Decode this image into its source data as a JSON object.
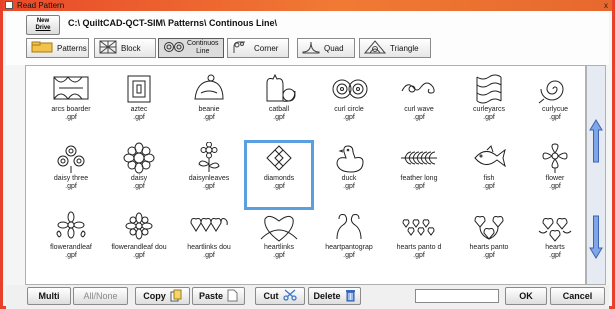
{
  "window": {
    "title": "Read Pattern",
    "close_glyph": "x"
  },
  "drive": {
    "label_top": "New",
    "label_bottom": "Drive"
  },
  "path": "C:\\ QuiltCAD-QCT-SIM\\ Patterns\\ Continous Line\\",
  "tabs": [
    {
      "label": "Patterns",
      "icon": "folder-icon"
    },
    {
      "label": "Block",
      "icon": "block-icon"
    },
    {
      "label_top": "Continuos",
      "label_bottom": "Line",
      "icon": "swirl-icon",
      "active": true
    },
    {
      "label": "Corner",
      "icon": "corner-icon"
    },
    {
      "label": "Quad",
      "icon": "quad-icon"
    },
    {
      "label": "Triangle",
      "icon": "triangle-icon"
    }
  ],
  "patterns": [
    {
      "name": "arcs boarder",
      "ext": ".gpf"
    },
    {
      "name": "aztec",
      "ext": ".gpf"
    },
    {
      "name": "beanie",
      "ext": ".gpf"
    },
    {
      "name": "catball",
      "ext": ".gpf"
    },
    {
      "name": "curl circle",
      "ext": ".gpf"
    },
    {
      "name": "curl wave",
      "ext": ".gpf"
    },
    {
      "name": "curleyarcs",
      "ext": ".gpf"
    },
    {
      "name": "curlycue",
      "ext": ".gpf"
    },
    {
      "name": "daisy three",
      "ext": ".gpf"
    },
    {
      "name": "daisy",
      "ext": ".gpf"
    },
    {
      "name": "daisynleaves",
      "ext": ".gpf"
    },
    {
      "name": "diamonds",
      "ext": ".gpf",
      "selected": true
    },
    {
      "name": "duck",
      "ext": ".gpf"
    },
    {
      "name": "feather long",
      "ext": ".gpf"
    },
    {
      "name": "fish",
      "ext": ".gpf"
    },
    {
      "name": "flower",
      "ext": ".gpf"
    },
    {
      "name": "flowerandleaf",
      "ext": ".gpf"
    },
    {
      "name": "flowerandleaf dou",
      "ext": ".gpf"
    },
    {
      "name": "heartlinks dou",
      "ext": ".gpf"
    },
    {
      "name": "heartlinks",
      "ext": ".gpf"
    },
    {
      "name": "heartpantograp",
      "ext": ".gpf"
    },
    {
      "name": "hearts panto d",
      "ext": ".gpf"
    },
    {
      "name": "hearts panto",
      "ext": ".gpf"
    },
    {
      "name": "hearts",
      "ext": ".gpf"
    }
  ],
  "bottom": {
    "multi": "Multi",
    "all_none": "All/None",
    "copy": "Copy",
    "paste": "Paste",
    "cut": "Cut",
    "delete": "Delete",
    "filename_value": "",
    "ok": "OK",
    "cancel": "Cancel"
  },
  "colors": {
    "title_bar": "#e94a2a",
    "selection": "#5aa0e0",
    "scroll_arrow": "#7fa6e6"
  }
}
